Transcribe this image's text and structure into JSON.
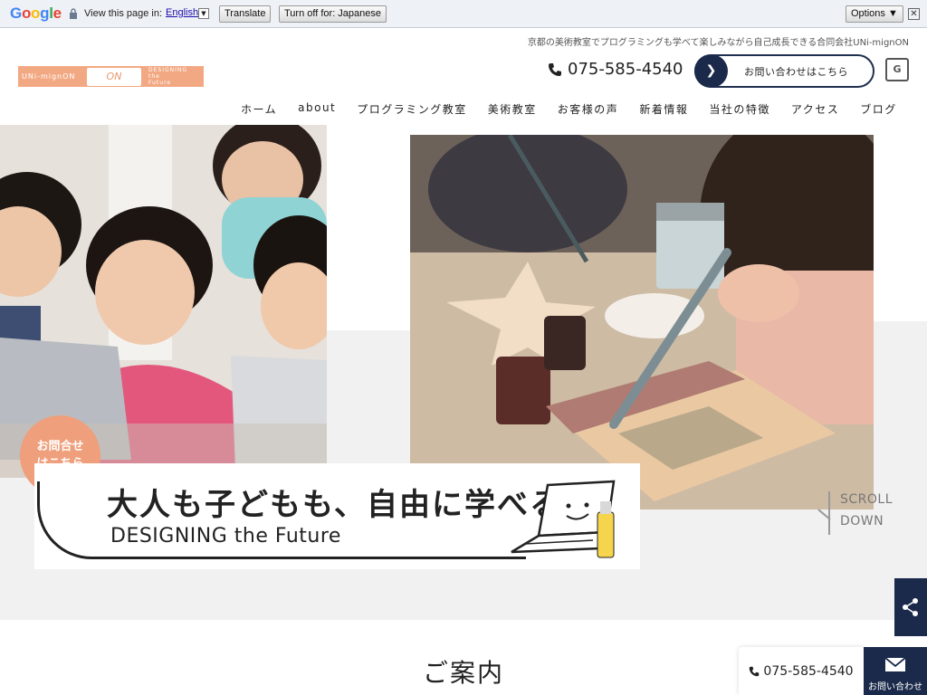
{
  "translate_bar": {
    "logo": "Google",
    "prompt": "View this page in:",
    "language": "English",
    "translate_button": "Translate",
    "turn_off_button": "Turn off for: Japanese",
    "options_button": "Options ▼",
    "close_symbol": "✕",
    "dropdown_symbol": "▼"
  },
  "header": {
    "tagline": "京都の美術教室でプログラミングも学べて楽しみながら自己成長できる合同会社UNi-mignON",
    "logo_text_left": "UNi-mignON",
    "logo_mark": "ON",
    "logo_text_right_1": "DESIGNING",
    "logo_text_right_2": "the",
    "logo_text_right_3": "Future",
    "phone": "075-585-4540",
    "contact_label": "お問い合わせはこちら",
    "translate_icon": "G"
  },
  "nav": {
    "items": [
      {
        "label": "ホーム"
      },
      {
        "label": "about"
      },
      {
        "label": "プログラミング教室"
      },
      {
        "label": "美術教室"
      },
      {
        "label": "お客様の声"
      },
      {
        "label": "新着情報"
      },
      {
        "label": "当社の特徴"
      },
      {
        "label": "アクセス"
      },
      {
        "label": "ブログ"
      }
    ]
  },
  "hero": {
    "bubble_line1": "お問合せ",
    "bubble_line2": "はこちら",
    "copy_main": "大人も子どもも、自由に学べる",
    "copy_sub": "DESIGNING the Future",
    "scroll_line1": "SCROLL",
    "scroll_line2": "DOWN"
  },
  "main": {
    "section_title": "ご案内"
  },
  "floating": {
    "phone": "075-585-4540",
    "mail_label": "お問い合わせ"
  },
  "icons": {
    "phone": "phone-icon",
    "share": "share-icon",
    "mail": "mail-icon",
    "lock": "lock-icon",
    "arrow": "chevron-right-icon"
  },
  "colors": {
    "navy": "#1b2a4b",
    "accent_peach": "#ef9f7b",
    "hero_bg": "#f1f1f1"
  }
}
